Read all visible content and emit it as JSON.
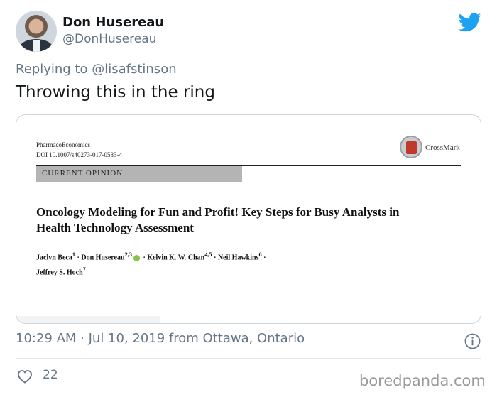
{
  "user": {
    "display_name": "Don Husereau",
    "handle": "@DonHusereau"
  },
  "tweet": {
    "replying_label": "Replying to",
    "replying_to": "@lisafstinson",
    "text": "Throwing this in the ring",
    "timestamp": "10:29 AM · Jul 10, 2019 from Ottawa, Ontario",
    "likes": "22"
  },
  "media": {
    "journal": "PharmacoEconomics",
    "doi": "DOI 10.1007/s40273-017-0583-4",
    "crossmark_label": "CrossMark",
    "category": "CURRENT OPINION",
    "title": "Oncology Modeling for Fun and Profit! Key Steps for Busy Analysts in Health Technology Assessment",
    "authors": {
      "a1": "Jaclyn Beca",
      "a1_sup": "1",
      "sep": " · ",
      "a2": "Don Husereau",
      "a2_sup": "2,3",
      "a3": "Kelvin K. W. Chan",
      "a3_sup": "4,5",
      "a4": "Neil Hawkins",
      "a4_sup": "6",
      "a5": "Jeffrey S. Hoch",
      "a5_sup": "7"
    }
  },
  "watermark": "boredpanda.com",
  "colors": {
    "twitter_blue": "#1da1f2",
    "secondary_text": "#657786",
    "border": "#ccd6dd"
  },
  "icons": [
    "twitter-bird-icon",
    "info-icon",
    "heart-icon",
    "crossmark-icon",
    "orcid-icon"
  ]
}
